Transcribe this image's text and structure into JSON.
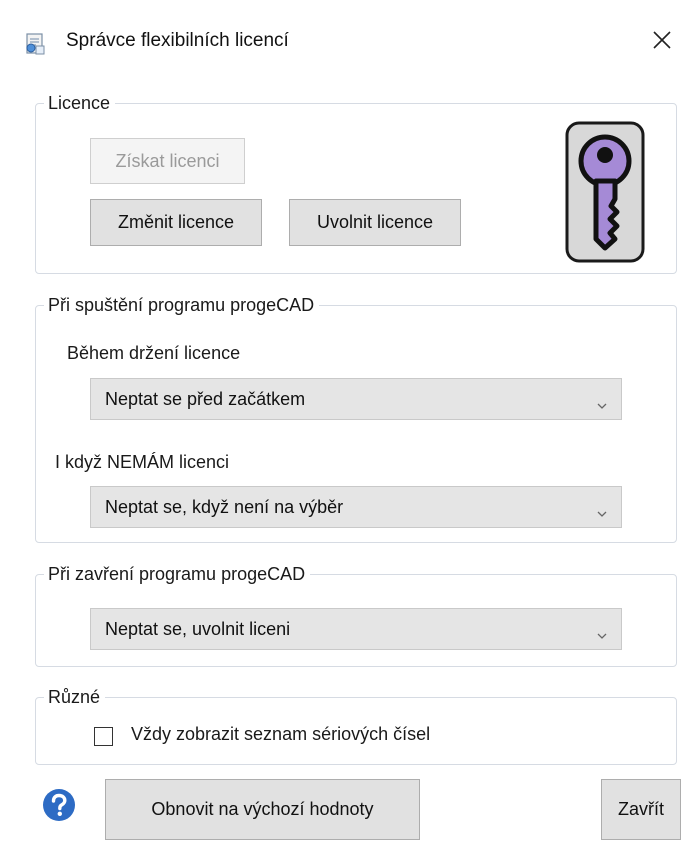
{
  "window": {
    "title": "Správce flexibilních licencí",
    "icons": {
      "app": "license-manager-icon",
      "close": "close-icon"
    }
  },
  "licence_group": {
    "legend": "Licence",
    "get_button": "Získat licenci",
    "change_button": "Změnit licence",
    "release_button": "Uvolnit licence",
    "icon": "key-icon",
    "key_color": "#a58ad6"
  },
  "startup_group": {
    "legend": "Při spuštění programu progeCAD",
    "holding_label": "Během držení licence",
    "holding_value": "Neptat se před začátkem",
    "no_licence_label": "I když NEMÁM licenci",
    "no_licence_value": "Neptat se, když není na výběr"
  },
  "close_group": {
    "legend": "Při zavření programu progeCAD",
    "value": "Neptat se, uvolnit liceni"
  },
  "misc_group": {
    "legend": "Různé",
    "checkbox_label": "Vždy zobrazit seznam sériových čísel",
    "checkbox_checked": false
  },
  "footer": {
    "help_icon": "help-icon",
    "reset_button": "Obnovit na výchozí hodnoty",
    "close_button": "Zavřít"
  }
}
